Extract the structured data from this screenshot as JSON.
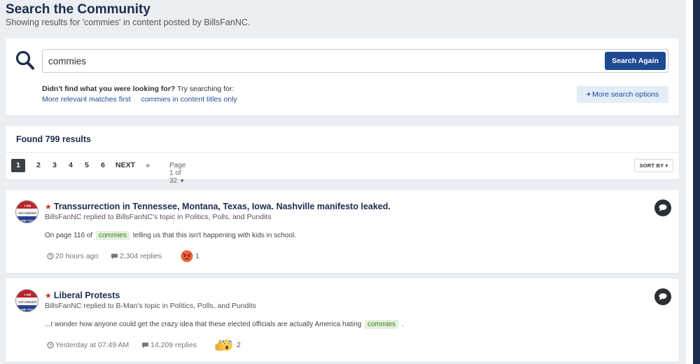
{
  "header": {
    "title": "Search the Community",
    "subtitle": "Showing results for 'commies' in content posted by BillsFanNC."
  },
  "search": {
    "query": "commies",
    "button_label": "Search Again",
    "didnt_find_bold": "Didn't find what you were looking for?",
    "didnt_find_rest": " Try searching for:",
    "suggestions": [
      "More relevant matches first",
      "commies in content titles only"
    ],
    "more_options_label": "More search options"
  },
  "results": {
    "found_label": "Found 799 results",
    "pages": [
      "1",
      "2",
      "3",
      "4",
      "5",
      "6"
    ],
    "active_page": "1",
    "next_label": "NEXT",
    "last_label": "»",
    "page_of_label": "Page 1 of 32",
    "sort_label": "SORT BY"
  },
  "items": [
    {
      "title": "Transsurrection in Tennessee, Montana, Texas, Iowa. Nashville manifesto leaked.",
      "meta": "BillsFanNC replied to BillsFanNC's topic in Politics, Polls, and Pundits",
      "snippet_before": "On page 116 of ",
      "snippet_highlight": "commies",
      "snippet_after": " telling us that this isn't happening with kids in school.",
      "time": "20 hours ago",
      "replies": "2,304 replies",
      "reaction_count": "1",
      "reaction_icon": "angry-face-icon"
    },
    {
      "title": "Liberal Protests",
      "meta": "BillsFanNC replied to B-Man's topic in Politics, Polls, and Pundits",
      "snippet_before": "...I wonder how anyone could get the crazy idea that these elected officials are actually America hating ",
      "snippet_highlight": "commies",
      "snippet_after": " .",
      "time": "Yesterday at 07:49 AM",
      "replies": "14,209 replies",
      "reaction_count": "2",
      "reaction_icon": "thumbs-up-shocked-icon"
    }
  ],
  "avatar": {
    "line1": "I AM",
    "line2": "ANTI-COMMUNIST",
    "line3": "ARE YOU?"
  },
  "colors": {
    "title_navy": "#1c2d4d",
    "link_blue": "#1f4a91",
    "background": "#ebeef2",
    "highlight_bg": "#e3f2dc",
    "star_red": "#c0392b"
  }
}
